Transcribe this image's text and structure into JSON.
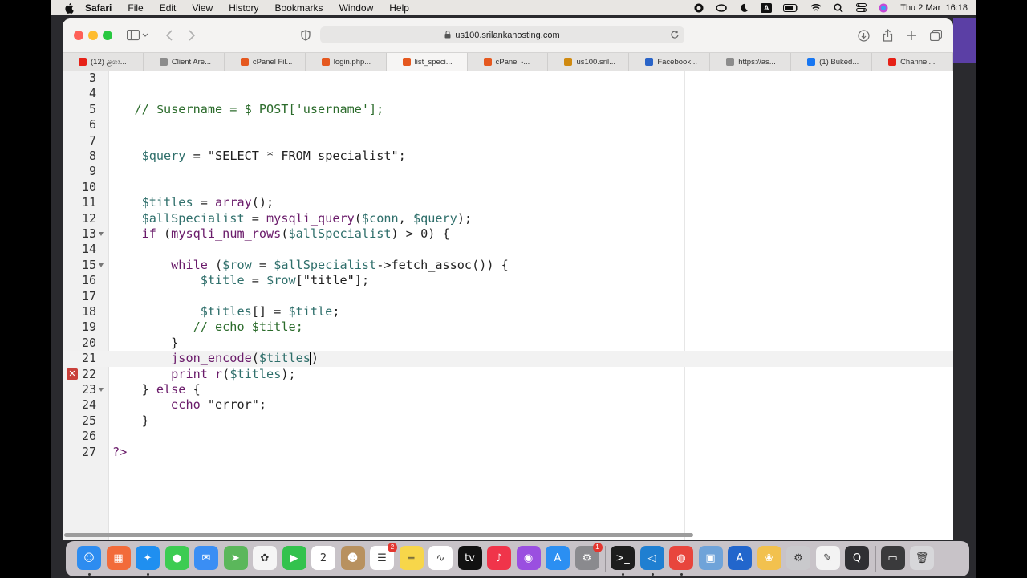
{
  "menubar": {
    "app": "Safari",
    "items": [
      "File",
      "Edit",
      "View",
      "History",
      "Bookmarks",
      "Window",
      "Help"
    ],
    "clock": "Thu 2 Mar  16:18",
    "input_source": "A"
  },
  "browser": {
    "url": "us100.srilankahosting.com",
    "tabs": [
      {
        "label": "(12) ළගා...",
        "favicon": "youtube-icon",
        "color": "#e62117"
      },
      {
        "label": "Client Are...",
        "favicon": "site-icon",
        "color": "#8c8c8c"
      },
      {
        "label": "cPanel Fil...",
        "favicon": "cpanel-icon",
        "color": "#e5581f"
      },
      {
        "label": "login.php...",
        "favicon": "cpanel-icon",
        "color": "#e5581f"
      },
      {
        "label": "list_speci...",
        "favicon": "cpanel-icon",
        "color": "#e5581f",
        "active": true
      },
      {
        "label": "cPanel -...",
        "favicon": "cpanel-icon",
        "color": "#e5581f"
      },
      {
        "label": "us100.sril...",
        "favicon": "host-icon",
        "color": "#d08a10"
      },
      {
        "label": "Facebook...",
        "favicon": "download-icon",
        "color": "#2a64c8"
      },
      {
        "label": "https://as...",
        "favicon": "site-icon",
        "color": "#8c8c8c"
      },
      {
        "label": "(1) Buked...",
        "favicon": "facebook-icon",
        "color": "#1877f2"
      },
      {
        "label": "Channel...",
        "favicon": "youtube-icon",
        "color": "#e62117"
      }
    ]
  },
  "editor": {
    "lines": [
      {
        "n": "3",
        "html": ""
      },
      {
        "n": "4",
        "html": ""
      },
      {
        "n": "5",
        "html": "   <span class='c'>// $username = $_POST['username'];</span>"
      },
      {
        "n": "6",
        "html": ""
      },
      {
        "n": "7",
        "html": ""
      },
      {
        "n": "8",
        "html": "    <span class='v'>$query</span> = <span class='s'>\"SELECT * FROM specialist\"</span>;"
      },
      {
        "n": "9",
        "html": ""
      },
      {
        "n": "10",
        "html": ""
      },
      {
        "n": "11",
        "html": "    <span class='v'>$titles</span> = <span class='k'>array</span>();"
      },
      {
        "n": "12",
        "html": "    <span class='v'>$allSpecialist</span> = <span class='k'>mysqli_query</span>(<span class='v'>$conn</span>, <span class='v'>$query</span>);"
      },
      {
        "n": "13",
        "html": "    <span class='k'>if</span> (<span class='k'>mysqli_num_rows</span>(<span class='v'>$allSpecialist</span>) &gt; 0) {",
        "fold": true
      },
      {
        "n": "14",
        "html": ""
      },
      {
        "n": "15",
        "html": "        <span class='k'>while</span> (<span class='v'>$row</span> = <span class='v'>$allSpecialist</span>-&gt;fetch_assoc()) {",
        "fold": true
      },
      {
        "n": "16",
        "html": "            <span class='v'>$title</span> = <span class='v'>$row</span>[<span class='s'>\"title\"</span>];"
      },
      {
        "n": "17",
        "html": ""
      },
      {
        "n": "18",
        "html": "            <span class='v'>$titles</span>[] = <span class='v'>$title</span>;"
      },
      {
        "n": "19",
        "html": "           <span class='c'>// echo $title;</span>"
      },
      {
        "n": "20",
        "html": "        }"
      },
      {
        "n": "21",
        "html": "        <span class='k'>json_encode</span>(<span class='v'>$titles</span><span class='cursor'></span>)",
        "current": true
      },
      {
        "n": "22",
        "html": "        <span class='k'>print_r</span>(<span class='v'>$titles</span>);",
        "error": true
      },
      {
        "n": "23",
        "html": "    } <span class='k'>else</span> {",
        "fold": true
      },
      {
        "n": "24",
        "html": "        <span class='k'>echo</span> <span class='s'>\"error\"</span>;"
      },
      {
        "n": "25",
        "html": "    }"
      },
      {
        "n": "26",
        "html": ""
      },
      {
        "n": "27",
        "html": "<span class='k'>?&gt;</span>"
      }
    ]
  },
  "dock": {
    "apps": [
      {
        "name": "finder-icon",
        "bg": "#2d8cf0",
        "glyph": "☺"
      },
      {
        "name": "launchpad-icon",
        "bg": "#f26b3a",
        "glyph": "▦"
      },
      {
        "name": "safari-icon",
        "bg": "#1f8ff0",
        "glyph": "✦"
      },
      {
        "name": "messages-icon",
        "bg": "#3dcc52",
        "glyph": "●"
      },
      {
        "name": "mail-icon",
        "bg": "#3a8ef4",
        "glyph": "✉"
      },
      {
        "name": "maps-icon",
        "bg": "#5bb75b",
        "glyph": "➤"
      },
      {
        "name": "photos-icon",
        "bg": "#f5f5f5",
        "glyph": "✿"
      },
      {
        "name": "facetime-icon",
        "bg": "#33c24d",
        "glyph": "▶"
      },
      {
        "name": "calendar-icon",
        "bg": "#ffffff",
        "glyph": "2"
      },
      {
        "name": "contacts-icon",
        "bg": "#b8915f",
        "glyph": "☻"
      },
      {
        "name": "reminders-icon",
        "bg": "#ffffff",
        "glyph": "☰",
        "badge": "2"
      },
      {
        "name": "notes-icon",
        "bg": "#f7d64a",
        "glyph": "≡"
      },
      {
        "name": "freeform-icon",
        "bg": "#ffffff",
        "glyph": "∿"
      },
      {
        "name": "apple-tv-icon",
        "bg": "#111111",
        "glyph": "tv"
      },
      {
        "name": "music-icon",
        "bg": "#f0344a",
        "glyph": "♪"
      },
      {
        "name": "podcasts-icon",
        "bg": "#9a4fe0",
        "glyph": "◉"
      },
      {
        "name": "app-store-icon",
        "bg": "#2b8ff2",
        "glyph": "A"
      },
      {
        "name": "system-settings-icon",
        "bg": "#8a8a8e",
        "glyph": "⚙",
        "badge": "1"
      },
      {
        "name": "terminal-icon",
        "bg": "#1d1d1d",
        "glyph": ">_"
      },
      {
        "name": "vscode-icon",
        "bg": "#1f7fd1",
        "glyph": "◁"
      },
      {
        "name": "chrome-icon",
        "bg": "#e8453c",
        "glyph": "◍"
      },
      {
        "name": "preview-icon",
        "bg": "#6fa3d9",
        "glyph": "▣"
      },
      {
        "name": "xcode-icon",
        "bg": "#2266cc",
        "glyph": "A"
      },
      {
        "name": "fruit-app-icon",
        "bg": "#f2c14e",
        "glyph": "❀"
      },
      {
        "name": "utility-icon",
        "bg": "#c9c9cc",
        "glyph": "⚙"
      },
      {
        "name": "textedit-icon",
        "bg": "#f3f3f3",
        "glyph": "✎"
      },
      {
        "name": "quicktime-icon",
        "bg": "#2f2f33",
        "glyph": "Q"
      },
      {
        "name": "screenshot-icon",
        "bg": "#3a3a3c",
        "glyph": "▭"
      },
      {
        "name": "trash-icon",
        "bg": "#d7d7da",
        "glyph": "🗑"
      }
    ]
  }
}
